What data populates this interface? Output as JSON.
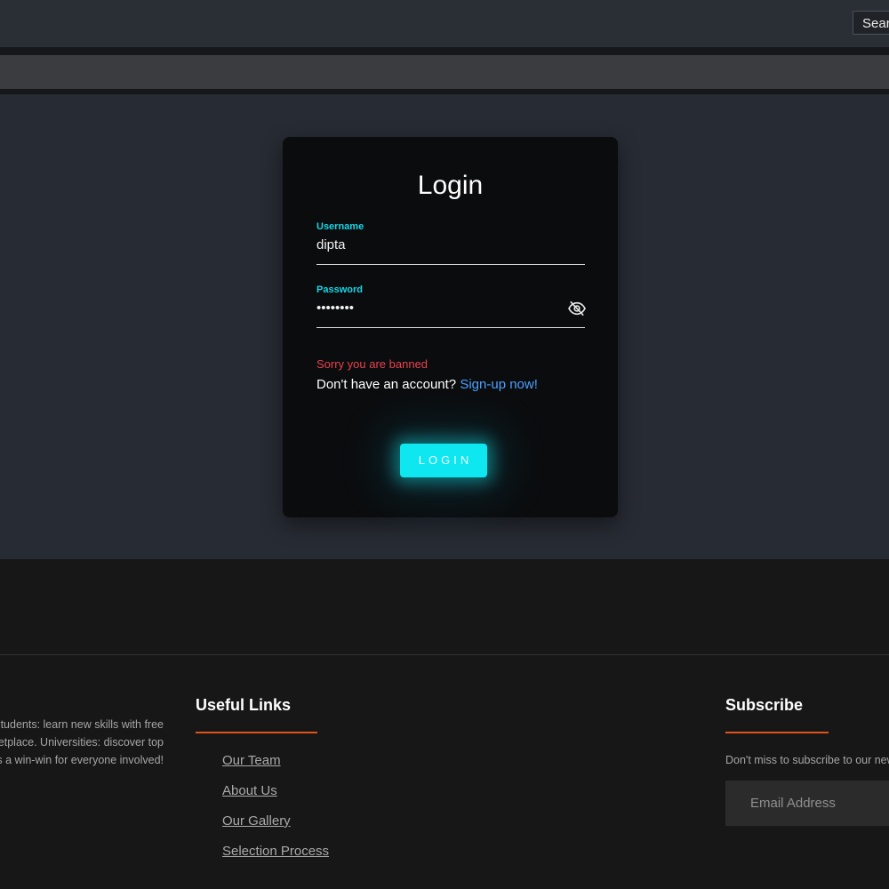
{
  "topbar": {
    "search_label": "Search"
  },
  "login_card": {
    "title": "Login",
    "username": {
      "label": "Username",
      "value": "dipta"
    },
    "password": {
      "label": "Password",
      "value": "••••••••"
    },
    "error_message": "Sorry you are banned",
    "signup_prompt": "Don't have an account?",
    "signup_link": "Sign-up now!",
    "login_button": "LOGIN"
  },
  "footer": {
    "about_lines": [
      "Students: learn new skills with free",
      "marketplace. Universities: discover top",
      "talent. It's a win-win for everyone involved!"
    ],
    "useful_links": {
      "heading": "Useful Links",
      "items": [
        "Our Team",
        "About Us",
        "Our Gallery",
        "Selection Process"
      ]
    },
    "subscribe": {
      "heading": "Subscribe",
      "text": "Don't miss to subscribe to our new feeds",
      "email_placeholder": "Email Address"
    }
  },
  "colors": {
    "accent_cyan": "#0ee6f0",
    "label_cyan": "#14d8e6",
    "error_red": "#e8414d",
    "link_blue": "#4ea0ff",
    "footer_underline": "#e0521a"
  }
}
